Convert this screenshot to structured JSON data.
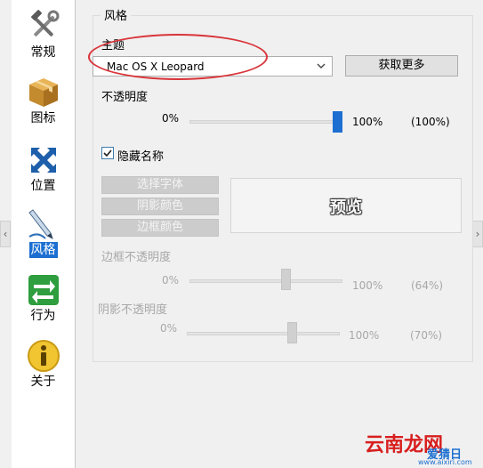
{
  "nav": {
    "items": [
      {
        "label": "常规",
        "icon": "tools-icon",
        "selected": false
      },
      {
        "label": "图标",
        "icon": "package-icon",
        "selected": false
      },
      {
        "label": "位置",
        "icon": "position-arrows-icon",
        "selected": false
      },
      {
        "label": "风格",
        "icon": "pen-icon",
        "selected": true
      },
      {
        "label": "行为",
        "icon": "swap-arrows-icon",
        "selected": false
      },
      {
        "label": "关于",
        "icon": "info-icon",
        "selected": false
      }
    ]
  },
  "style": {
    "group_title": "风格",
    "theme_label": "主题",
    "theme_value": "Mac OS X Leopard",
    "get_more_label": "获取更多",
    "opacity_label": "不透明度",
    "opacity_min": "0%",
    "opacity_max": "100%",
    "opacity_value": "(100%)",
    "opacity_level": 1.0,
    "hide_names_label": "隐藏名称",
    "hide_names_checked": true,
    "choose_font_label": "选择字体",
    "shadow_color_label": "阴影颜色",
    "border_color_label": "边框颜色",
    "preview_text": "预览",
    "border_opacity_label": "边框不透明度",
    "border_opacity_min": "0%",
    "border_opacity_max": "100%",
    "border_opacity_value": "(64%)",
    "border_opacity_level": 0.64,
    "shadow_opacity_label": "阴影不透明度",
    "shadow_opacity_min": "0%",
    "shadow_opacity_max": "100%",
    "shadow_opacity_value": "(70%)",
    "shadow_opacity_level": 0.7
  },
  "watermark": {
    "brand": "云南龙网",
    "site_name": "爱猜日",
    "site_url": "www.aixiri.com"
  },
  "colors": {
    "accent": "#1c6fd1",
    "highlight_ring": "#d9353a"
  }
}
